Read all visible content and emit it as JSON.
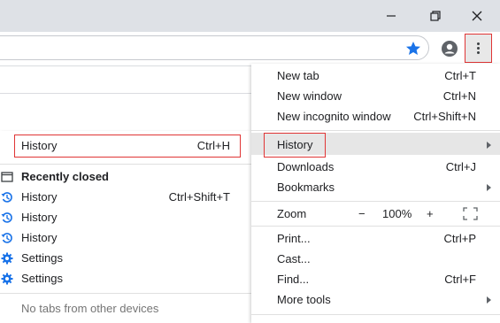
{
  "colors": {
    "accent_blue": "#1a73e8",
    "highlight_red": "#e03535",
    "menu_hover": "#e6e6e6"
  },
  "history_submenu": {
    "header": {
      "label": "History",
      "shortcut": "Ctrl+H"
    },
    "recently_closed_label": "Recently closed",
    "items": [
      {
        "icon": "history-clock-icon",
        "label": "History",
        "shortcut": "Ctrl+Shift+T"
      },
      {
        "icon": "history-clock-icon",
        "label": "History",
        "shortcut": ""
      },
      {
        "icon": "history-clock-icon",
        "label": "History",
        "shortcut": ""
      },
      {
        "icon": "settings-gear-icon",
        "label": "Settings",
        "shortcut": ""
      },
      {
        "icon": "settings-gear-icon",
        "label": "Settings",
        "shortcut": ""
      }
    ],
    "footer": "No tabs from other devices"
  },
  "main_menu": {
    "new_tab": {
      "label": "New tab",
      "shortcut": "Ctrl+T"
    },
    "new_window": {
      "label": "New window",
      "shortcut": "Ctrl+N"
    },
    "new_incognito": {
      "label": "New incognito window",
      "shortcut": "Ctrl+Shift+N"
    },
    "history": {
      "label": "History"
    },
    "downloads": {
      "label": "Downloads",
      "shortcut": "Ctrl+J"
    },
    "bookmarks": {
      "label": "Bookmarks"
    },
    "zoom": {
      "label": "Zoom",
      "minus": "−",
      "value": "100%",
      "plus": "+"
    },
    "print": {
      "label": "Print...",
      "shortcut": "Ctrl+P"
    },
    "cast": {
      "label": "Cast..."
    },
    "find": {
      "label": "Find...",
      "shortcut": "Ctrl+F"
    },
    "more_tools": {
      "label": "More tools"
    }
  }
}
